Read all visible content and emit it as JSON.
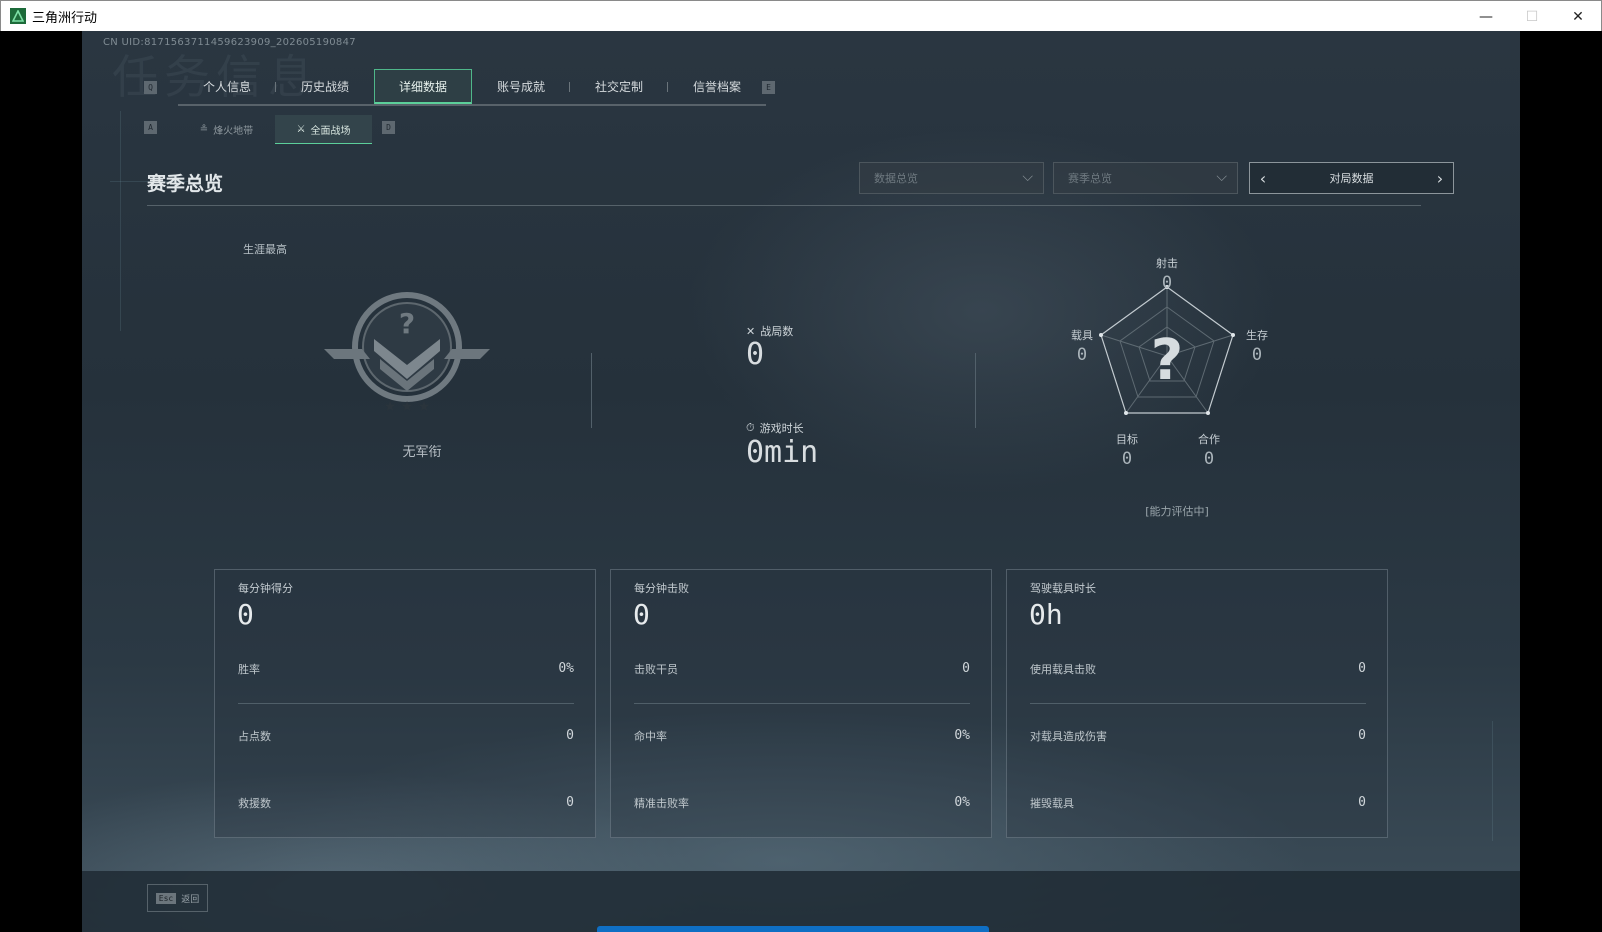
{
  "window": {
    "title": "三角洲行动",
    "minimize": "—",
    "maximize": "☐",
    "close": "✕"
  },
  "uid": "CN UID:8171563711459623909_202605190847",
  "background_text": "任务信息",
  "nav": {
    "left_key": "Q",
    "right_key": "E",
    "tabs": [
      {
        "label": "个人信息",
        "active": false
      },
      {
        "label": "历史战绩",
        "active": false
      },
      {
        "label": "详细数据",
        "active": true
      },
      {
        "label": "账号成就",
        "active": false
      },
      {
        "label": "社交定制",
        "active": false
      },
      {
        "label": "信誉档案",
        "active": false
      }
    ]
  },
  "subnav": {
    "left_key": "A",
    "right_key": "D",
    "tabs": [
      {
        "label": "烽火地带",
        "icon": "fire-zone-icon",
        "active": false
      },
      {
        "label": "全面战场",
        "icon": "warfare-icon",
        "active": true
      }
    ]
  },
  "section": {
    "title": "赛季总览"
  },
  "filters": {
    "data_overview": "数据总览",
    "season_overview": "赛季总览",
    "pager_label": "对局数据"
  },
  "career": {
    "label": "生涯最高",
    "rank": "无军衔"
  },
  "summary": {
    "matches_label": "战局数",
    "matches_value": "0",
    "playtime_label": "游戏时长",
    "playtime_value": "0min"
  },
  "radar": {
    "center": "?",
    "axes": [
      {
        "label": "射击",
        "value": "0"
      },
      {
        "label": "生存",
        "value": "0"
      },
      {
        "label": "合作",
        "value": "0"
      },
      {
        "label": "目标",
        "value": "0"
      },
      {
        "label": "载具",
        "value": "0"
      }
    ],
    "status": "[能力评估中]"
  },
  "cards": [
    {
      "head_label": "每分钟得分",
      "head_value": "0",
      "rows": [
        {
          "label": "胜率",
          "value": "0%"
        },
        {
          "label": "占点数",
          "value": "0"
        },
        {
          "label": "救援数",
          "value": "0"
        }
      ]
    },
    {
      "head_label": "每分钟击败",
      "head_value": "0",
      "rows": [
        {
          "label": "击败干员",
          "value": "0"
        },
        {
          "label": "命中率",
          "value": "0%"
        },
        {
          "label": "精准击败率",
          "value": "0%"
        }
      ]
    },
    {
      "head_label": "驾驶载具时长",
      "head_value": "0h",
      "rows": [
        {
          "label": "使用载具击败",
          "value": "0"
        },
        {
          "label": "对载具造成伤害",
          "value": "0"
        },
        {
          "label": "摧毁载具",
          "value": "0"
        }
      ]
    }
  ],
  "footer": {
    "esc_key": "Esc",
    "back_label": "返回"
  },
  "colors": {
    "accent": "#5ccf9a",
    "background": "#26323c",
    "progress": "#0f6fc4"
  }
}
